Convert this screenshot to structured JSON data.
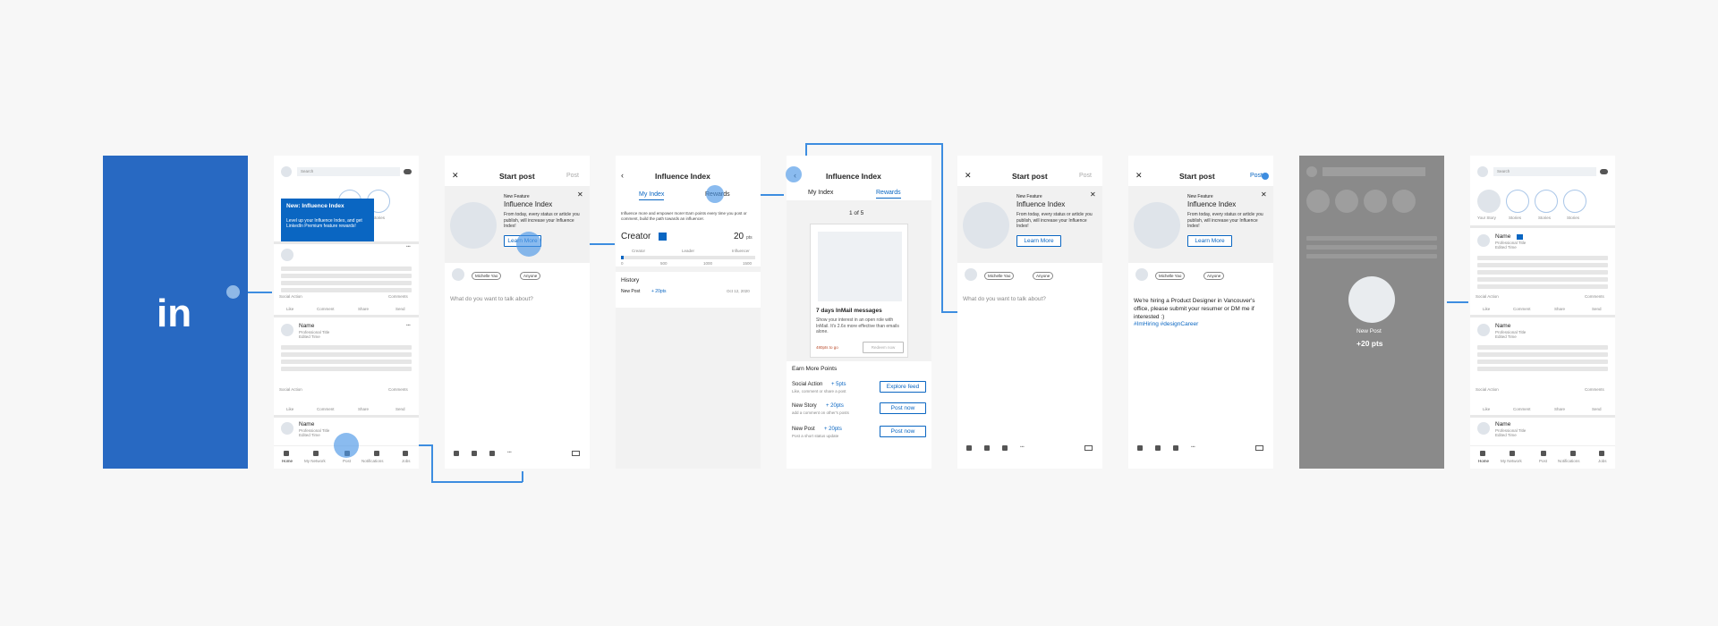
{
  "splash": {
    "logo": "in",
    "bg": "#2869c2"
  },
  "feed": {
    "search": "Search",
    "stories": [
      "Stories"
    ],
    "tip_title": "New: Influence Index",
    "tip_body": "Level up your Influence Index, and get LinkedIn Premium feature rewards!",
    "post_name": "Name",
    "post_title": "Professional Title",
    "post_time": "Edited Time",
    "social_action": "Social Action",
    "comments": "Comments",
    "actions": [
      "Like",
      "Comment",
      "Share",
      "Send"
    ],
    "nav": [
      "Home",
      "My Network",
      "Post",
      "Notifications",
      "Jobs"
    ]
  },
  "start": {
    "title": "Start post",
    "post": "Post",
    "new_feature": "New Feature",
    "feature_title": "Influence Index",
    "feature_body": "From today, every status or article you publish, will increase your Influence Index!",
    "learn_more": "Learn More",
    "audience_name": "Michelle Yao",
    "audience": "Anyone",
    "placeholder": "What do you want to talk about?"
  },
  "index": {
    "title": "Influence Index",
    "tab_my": "My Index",
    "tab_rewards": "Rewards",
    "intro": "Influence more and empower more! Earn points every time you post or comment, build the path towards an influencer.",
    "level": "Creator",
    "points": "20",
    "pts": "pts",
    "scale": [
      "Creator",
      "Leader",
      "Influencer"
    ],
    "ticks": [
      "0",
      "500",
      "1000",
      "1500"
    ],
    "history": "History",
    "hist_item": "New Post",
    "hist_points": "+ 20pts",
    "hist_date": "Oct 12, 2020"
  },
  "rewards": {
    "page": "1 of 5",
    "card_title": "7 days InMail messages",
    "card_body": "Show your interest in an open role with InMail. It's 2.6x more effective than emails alone.",
    "to_go": "480pts to go",
    "redeem": "Redeem now",
    "earn": "Earn More Points",
    "rows": [
      {
        "label": "Social Action",
        "pts": "+ 5pts",
        "sub": "Like, comment or share a post",
        "btn": "Explore feed"
      },
      {
        "label": "New Story",
        "pts": "+ 20pts",
        "sub": "add a comment on other's posts",
        "btn": "Post now"
      },
      {
        "label": "New Post",
        "pts": "+ 20pts",
        "sub": "Post a short status update",
        "btn": "Post now"
      }
    ]
  },
  "composed": {
    "text": "We're hiring a Product Designer in Vancouver's office, please submit your resumer or DM me if interested :)",
    "tags": "#ImHiring #designCareer"
  },
  "toast": {
    "label": "New Post",
    "points": "+20 pts"
  },
  "final": {
    "your_story": "Your Story"
  }
}
